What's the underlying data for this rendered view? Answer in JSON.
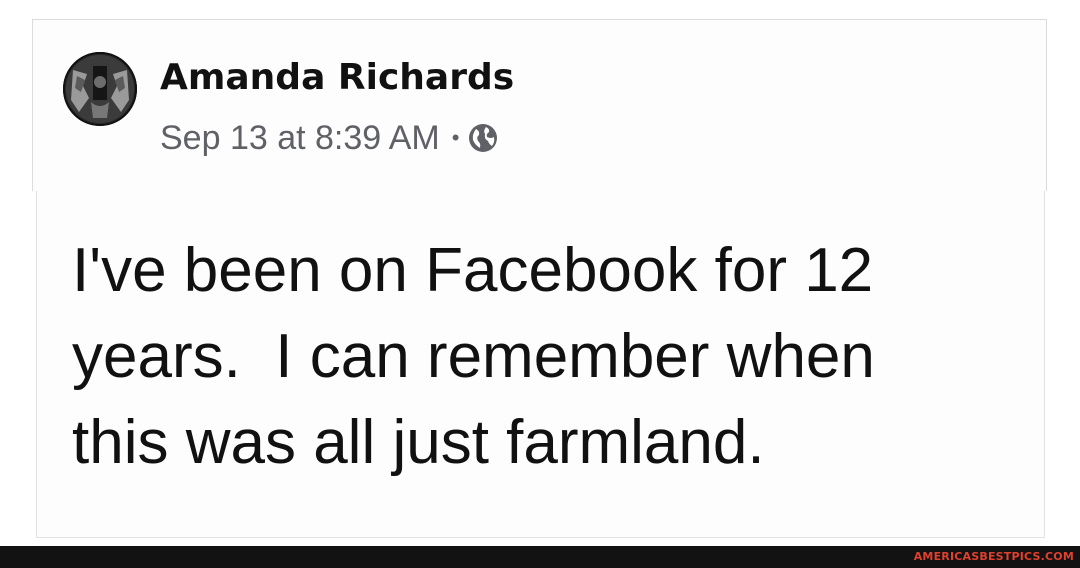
{
  "post": {
    "author_name": "Amanda Richards",
    "timestamp": "Sep 13 at 8:39 AM",
    "separator": "•",
    "privacy_icon": "globe-icon",
    "body_lines": [
      "I've been on Facebook for 12",
      "years.  I can remember when",
      "this was all just farmland."
    ]
  },
  "footer": {
    "watermark": "AMERICASBESTPICS.COM",
    "watermark_color": "#e0402e",
    "bar_color": "#121212"
  }
}
